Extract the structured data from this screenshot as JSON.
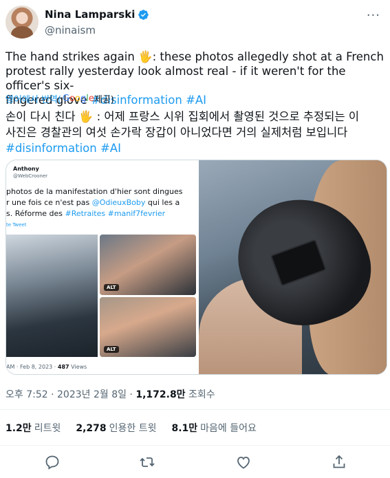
{
  "author": {
    "name": "Nina Lamparski",
    "handle": "@ninaism"
  },
  "tweet": {
    "text_lines": [
      "The hand strikes again 🖐: these photos allegedly shot at a French",
      "protest rally yesterday look almost real - if it weren't for the officer's six-",
      "fingered glove "
    ],
    "hashtags": [
      "#disinformation",
      "#AI"
    ],
    "translate_label": "영어에서 번역(",
    "google_label": "Google",
    "provided_label": " 제공)",
    "translated_lines": [
      "손이 다시 친다 🖐 : 어제 프랑스 시위 집회에서 촬영된 것으로 추정되는 이",
      "사진은 경찰관의 여섯 손가락 장갑이 아니었다면 거의 실제처럼 보입니다"
    ],
    "translated_hashtags": [
      "#disinformation",
      "#AI"
    ]
  },
  "quoted": {
    "author": "Anthony",
    "handle": "@WebCrooner",
    "line1": "photos de la manifestation d'hier sont dingues",
    "line2_prefix": "r une fois ce n'est pas ",
    "line2_link": "@OdieuxBoby",
    "line2_suffix": " qui les a",
    "line3_prefix": "s. Réforme des ",
    "line3_links": "#Retraites #manif7fevrier",
    "translate": "te Tweet",
    "alt": "ALT",
    "date": "AM · Feb 8, 2023 · ",
    "views_count": "487",
    "views_label": " Views"
  },
  "meta": {
    "time": "오후 7:52 · 2023년 2월 8일 · ",
    "views": "1,172.8만",
    "views_label": " 조회수"
  },
  "stats": {
    "retweets": "1.2만",
    "retweets_label": "리트윗",
    "quotes": "2,278",
    "quotes_label": "인용한 트윗",
    "likes": "8.1만",
    "likes_label": "마음에 들어요"
  },
  "colors": {
    "link": "#1d9bf0",
    "secondary": "#536471",
    "primary": "#0f1419"
  }
}
